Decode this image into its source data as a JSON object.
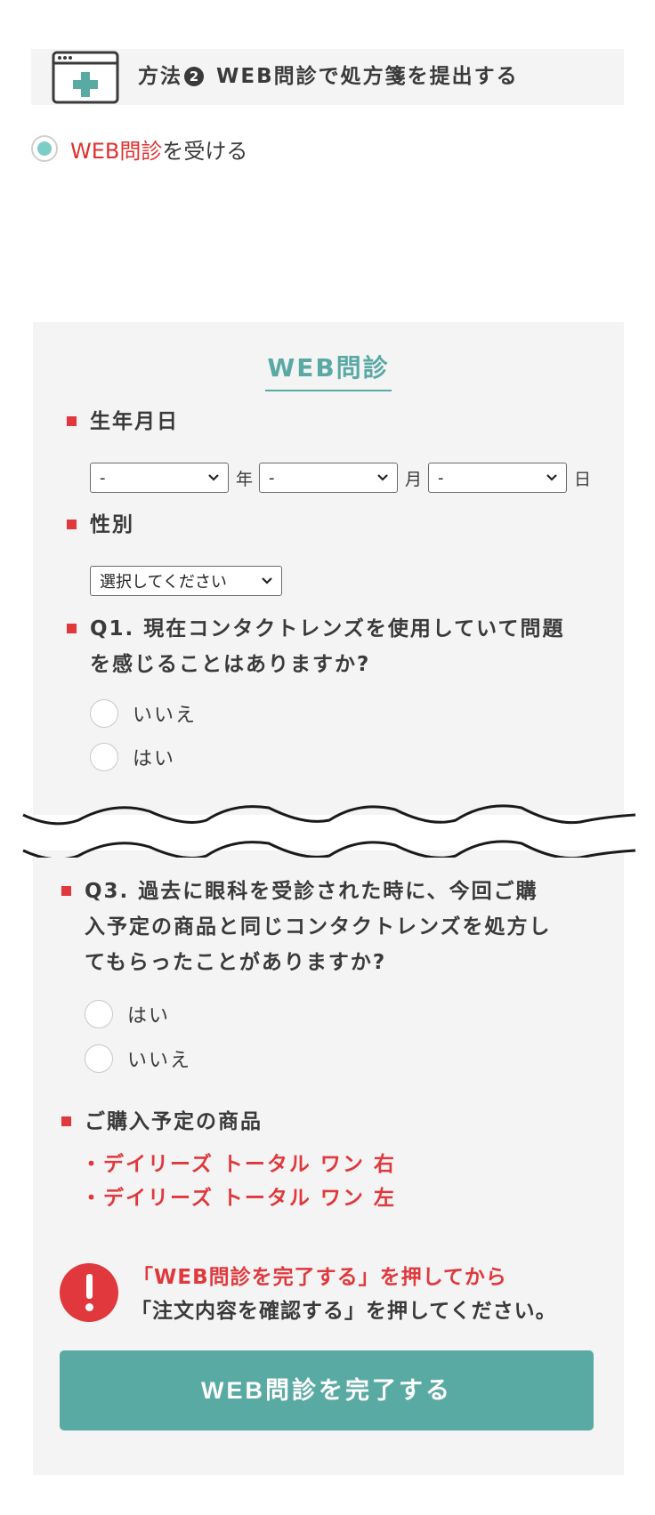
{
  "method": {
    "label": "方法",
    "number": "2",
    "title": "WEB問診で処方箋を提出する"
  },
  "receive_option": {
    "highlight": "WEB問診",
    "rest": "を受ける"
  },
  "form": {
    "title": "WEB問診",
    "birthdate": {
      "label": "生年月日",
      "year_value": "-",
      "year_unit": "年",
      "month_value": "-",
      "month_unit": "月",
      "day_value": "-",
      "day_unit": "日"
    },
    "gender": {
      "label": "性別",
      "value": "選択してください"
    },
    "q1": {
      "line1": "Q1. 現在コンタクトレンズを使用していて問題",
      "line2": "を感じることはありますか?",
      "options": [
        "いいえ",
        "はい"
      ]
    },
    "q3": {
      "line1": "Q3. 過去に眼科を受診された時に、今回ご購",
      "line2": "入予定の商品と同じコンタクトレンズを処方し",
      "line3": "てもらったことがありますか?",
      "options": [
        "はい",
        "いいえ"
      ]
    },
    "products": {
      "label": "ご購入予定の商品",
      "items": [
        "・デイリーズ トータル ワン 右",
        "・デイリーズ トータル ワン 左"
      ]
    },
    "notice": {
      "line1": "「WEB問診を完了する」を押してから",
      "line2": "「注文内容を確認する」を押してください。"
    },
    "complete_button": "WEB問診を完了する"
  },
  "colors": {
    "accent_teal": "#5aaaa4",
    "alert_red": "#e0383c",
    "panel_bg": "#f4f4f4"
  }
}
